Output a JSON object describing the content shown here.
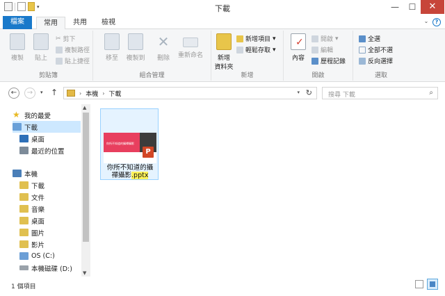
{
  "window": {
    "title": "下載",
    "minimize": "—",
    "maximize": "☐",
    "close": "✕"
  },
  "tabs": [
    {
      "label": "檔案"
    },
    {
      "label": "常用"
    },
    {
      "label": "共用"
    },
    {
      "label": "檢視"
    }
  ],
  "ribbon_toggle": {
    "expand": "⌄",
    "help": "?"
  },
  "ribbon": {
    "clipboard": {
      "copy": "複製",
      "paste": "貼上",
      "cut": "剪下",
      "copy_path": "複製路徑",
      "paste_shortcut": "貼上捷徑",
      "label": "剪貼簿"
    },
    "organize": {
      "move_to": "移至",
      "copy_to": "複製到",
      "delete": "刪除",
      "rename": "重新命名",
      "label": "組合管理"
    },
    "new": {
      "new_folder_line1": "新增",
      "new_folder_line2": "資料夾",
      "new_item": "新增項目",
      "easy_access": "輕鬆存取",
      "label": "新增"
    },
    "open": {
      "properties": "內容",
      "open": "開啟",
      "edit": "編輯",
      "history": "歷程記錄",
      "label": "開啟"
    },
    "select": {
      "select_all": "全選",
      "select_none": "全部不選",
      "invert": "反向選擇",
      "label": "選取"
    }
  },
  "nav": {
    "back": "←",
    "forward": "→",
    "recent": "▾",
    "up": "↑"
  },
  "address": {
    "crumbs": [
      "本機",
      "下載"
    ],
    "separator": "›",
    "dropdown": "▾",
    "refresh": "↻"
  },
  "search": {
    "placeholder": "搜尋 下載",
    "icon": "⌕"
  },
  "navpane": {
    "favorites_header": "我的最愛",
    "favorites": [
      "下載",
      "桌面",
      "最近的位置"
    ],
    "computer_header": "本機",
    "computer": [
      "下載",
      "文件",
      "音樂",
      "桌面",
      "圖片",
      "影片",
      "OS (C:)",
      "本機磁碟 (D:)"
    ]
  },
  "file": {
    "name_line1": "你所不知道的攝",
    "name_line2": "禪攝影",
    "ext": ".pptx",
    "slide_caption": "你所不知道的攝禪攝影",
    "badge": "P"
  },
  "scroll": {
    "up": "▲",
    "down": "▼"
  },
  "status": {
    "count": "1 個項目"
  },
  "colors": {
    "accent": "#1979ca",
    "selection": "#cde8ff",
    "close": "#c7453a",
    "highlight": "#fff35a",
    "ppt": "#d24726"
  }
}
